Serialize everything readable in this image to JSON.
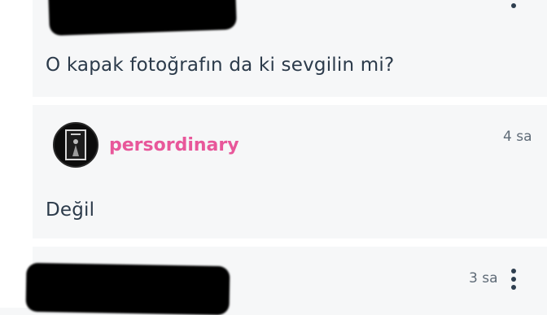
{
  "comments": [
    {
      "text": "O kapak fotoğrafın da ki sevgilin mi?"
    },
    {
      "username": "persordinary",
      "time": "4 sa",
      "text": "Değil"
    },
    {
      "time": "3 sa"
    }
  ],
  "icons": {
    "more": "more-vertical-icon",
    "avatar": "profile-photo"
  },
  "colors": {
    "username": "#e8579a",
    "text": "#2b3a4a",
    "time": "#5f6b77",
    "background": "#f6f7f8"
  }
}
